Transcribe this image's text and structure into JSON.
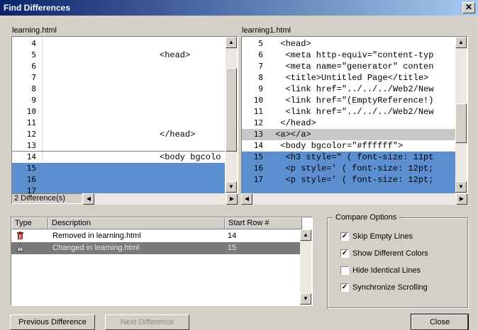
{
  "window": {
    "title": "Find Differences",
    "close_glyph": "✕"
  },
  "left": {
    "filename": "learning.html",
    "lines": [
      {
        "n": "4",
        "code": ""
      },
      {
        "n": "5",
        "code": "<head>"
      },
      {
        "n": "6",
        "code": ""
      },
      {
        "n": "7",
        "code": ""
      },
      {
        "n": "8",
        "code": ""
      },
      {
        "n": "9",
        "code": ""
      },
      {
        "n": "10",
        "code": ""
      },
      {
        "n": "11",
        "code": ""
      },
      {
        "n": "12",
        "code": "</head>"
      },
      {
        "n": "13",
        "code": ""
      },
      {
        "n": "14",
        "code": "<body bgcolo"
      },
      {
        "n": "15",
        "code": ""
      },
      {
        "n": "16",
        "code": ""
      },
      {
        "n": "17",
        "code": ""
      }
    ],
    "status": "2 Difference(s)"
  },
  "right": {
    "filename": "learning1.html",
    "lines": [
      {
        "n": "5",
        "code": "  <head>"
      },
      {
        "n": "6",
        "code": "   <meta http-equiv=\"content-typ"
      },
      {
        "n": "7",
        "code": "   <meta name=\"generator\" conten"
      },
      {
        "n": "8",
        "code": "   <title>Untitled Page</title>"
      },
      {
        "n": "9",
        "code": "   <link href=\"../../../Web2/New"
      },
      {
        "n": "10",
        "code": "   <link href=\"(EmptyReference!)"
      },
      {
        "n": "11",
        "code": "   <link href=\"../../../Web2/New"
      },
      {
        "n": "12",
        "code": "  </head>"
      },
      {
        "n": "13",
        "code": " <a></a>"
      },
      {
        "n": "14",
        "code": "  <body bgcolor=\"#ffffff\">"
      },
      {
        "n": "15",
        "code": "   <h3 style=\" ( font-size: 11pt"
      },
      {
        "n": "16",
        "code": "   <p style=' ( font-size: 12pt;"
      },
      {
        "n": "17",
        "code": "   <p style=' ( font-size: 12pt;"
      }
    ]
  },
  "differences": {
    "columns": [
      "Type",
      "Description",
      "Start Row #"
    ],
    "rows": [
      {
        "icon": "trash-icon",
        "description": "Removed in learning.html",
        "start_row": "14"
      },
      {
        "icon": "warning-icon",
        "description": "Changed in learning.html",
        "start_row": "15"
      }
    ]
  },
  "compare_options": {
    "title": "Compare Options",
    "items": [
      {
        "label": "Skip Empty Lines",
        "checked": true
      },
      {
        "label": "Show Different Colors",
        "checked": true
      },
      {
        "label": "Hide Identical Lines",
        "checked": false
      },
      {
        "label": "Synchronize Scrolling",
        "checked": true
      }
    ]
  },
  "buttons": {
    "previous": "Previous Difference",
    "next": "Next Difference",
    "close": "Close"
  },
  "colors": {
    "diff_blue": "#5b8fcf",
    "removed_gray": "#c8c8c8",
    "selected_row": "#7a7a7a"
  }
}
